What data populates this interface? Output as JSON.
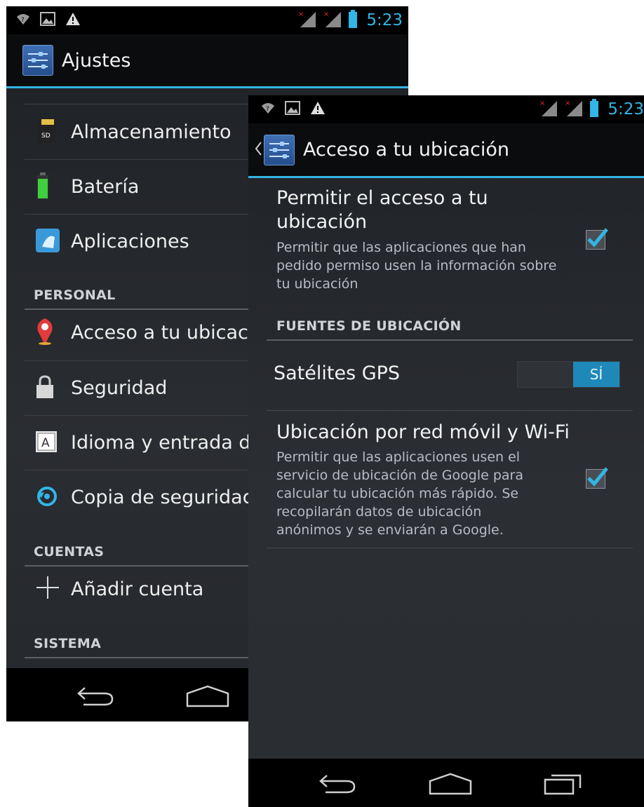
{
  "back_screen": {
    "status": {
      "time": "5:23"
    },
    "action_bar": {
      "title": "Ajustes"
    },
    "items": [
      {
        "label": "Almacenamiento"
      },
      {
        "label": "Batería"
      },
      {
        "label": "Aplicaciones"
      },
      {
        "label": "Acceso a tu ubicación"
      },
      {
        "label": "Seguridad"
      },
      {
        "label": "Idioma y entrada de texto"
      },
      {
        "label": "Copia de seguridad"
      },
      {
        "label": "Añadir cuenta"
      }
    ],
    "sections": {
      "personal": "PERSONAL",
      "cuentas": "CUENTAS",
      "sistema": "SISTEMA"
    }
  },
  "front_screen": {
    "status": {
      "time": "5:23"
    },
    "action_bar": {
      "title": "Acceso a tu ubicación"
    },
    "allow_access": {
      "title": "Permitir el acceso a tu ubicación",
      "summary": "Permitir que las aplicaciones que han pedido permiso usen la información sobre tu ubicación",
      "checked": true
    },
    "section_header": "FUENTES DE UBICACIÓN",
    "gps": {
      "label": "Satélites GPS",
      "toggle_label": "SÍ",
      "on": true
    },
    "network": {
      "title": "Ubicación por red móvil y Wi-Fi",
      "summary": "Permitir que las aplicaciones usen el servicio de ubicación de Google para calcular tu ubicación más rápido. Se recopilarán datos de ubicación anónimos y se enviarán a Google.",
      "checked": true
    }
  },
  "colors": {
    "accent": "#33b5e5",
    "background": "#25282c",
    "bar": "#000000"
  }
}
